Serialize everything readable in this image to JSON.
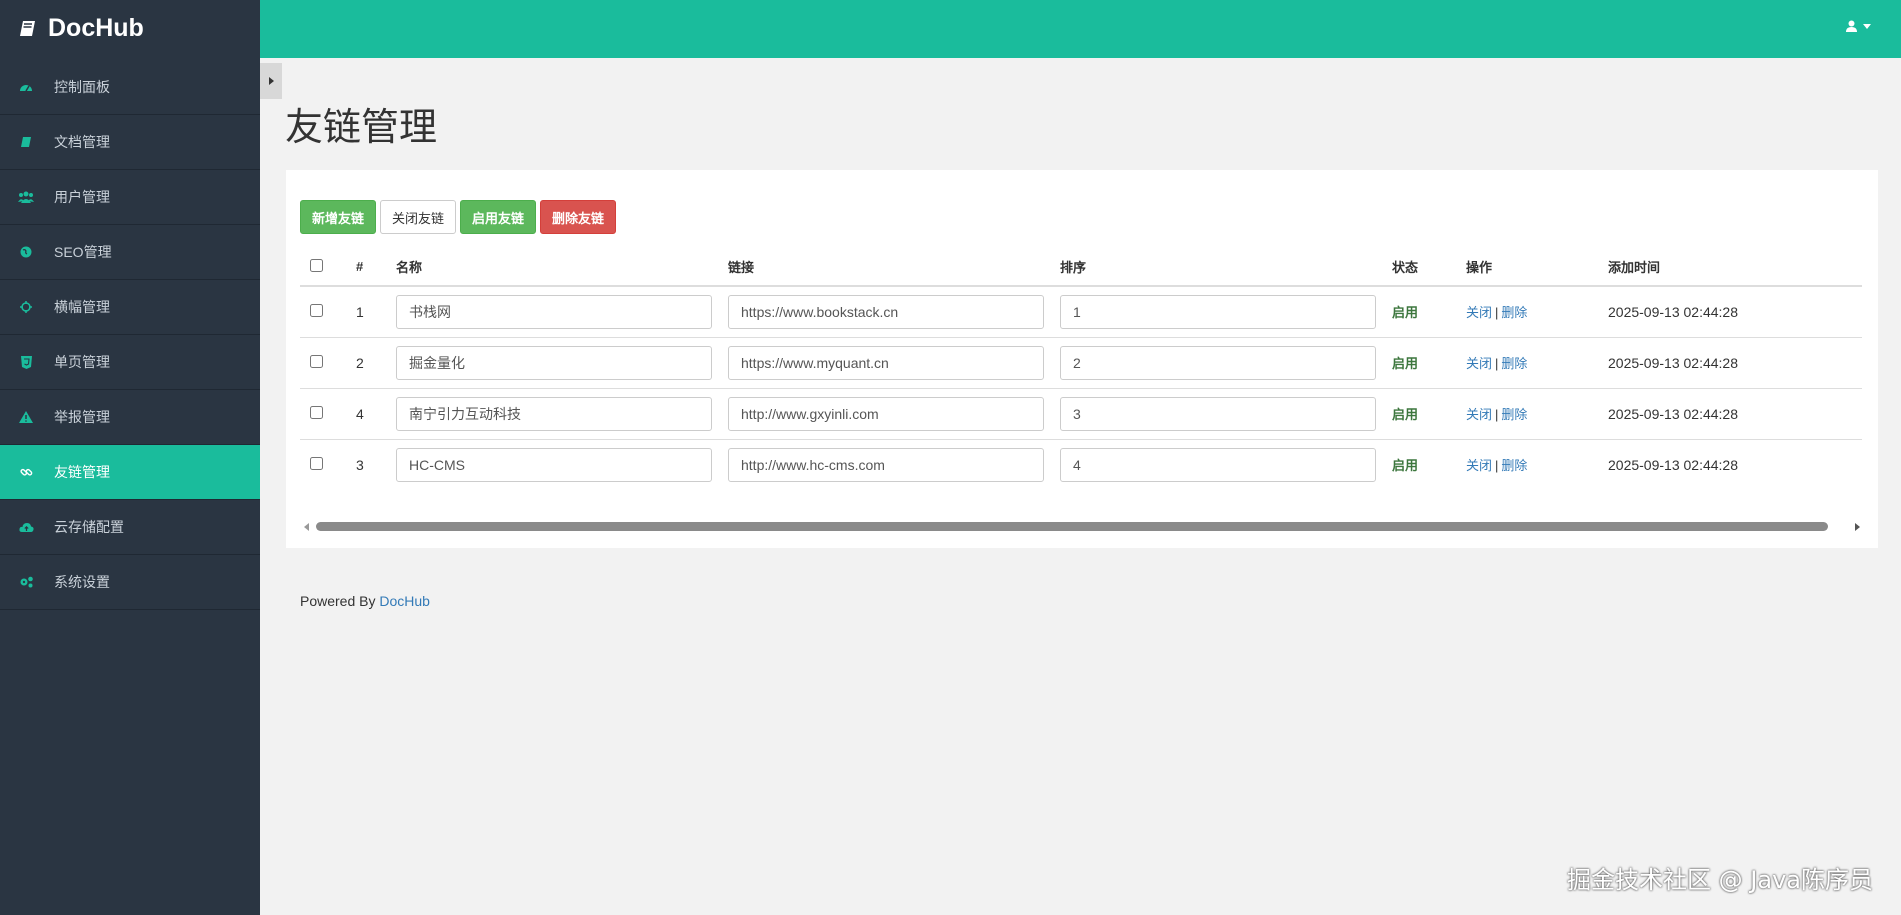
{
  "brand": {
    "name": "DocHub",
    "icon": "book-icon"
  },
  "sidebar": {
    "items": [
      {
        "label": "控制面板",
        "icon": "dashboard-icon",
        "active": false
      },
      {
        "label": "文档管理",
        "icon": "book-icon",
        "active": false
      },
      {
        "label": "用户管理",
        "icon": "users-icon",
        "active": false
      },
      {
        "label": "SEO管理",
        "icon": "globe-icon",
        "active": false
      },
      {
        "label": "横幅管理",
        "icon": "crosshairs-icon",
        "active": false
      },
      {
        "label": "单页管理",
        "icon": "html5-icon",
        "active": false
      },
      {
        "label": "举报管理",
        "icon": "warning-icon",
        "active": false
      },
      {
        "label": "友链管理",
        "icon": "link-icon",
        "active": true
      },
      {
        "label": "云存储配置",
        "icon": "cloud-upload-icon",
        "active": false
      },
      {
        "label": "系统设置",
        "icon": "gears-icon",
        "active": false
      }
    ]
  },
  "topbar": {
    "user_icon": "user-icon"
  },
  "page": {
    "title": "友链管理"
  },
  "toolbar": {
    "add_label": "新增友链",
    "close_label": "关闭友链",
    "enable_label": "启用友链",
    "delete_label": "删除友链"
  },
  "table": {
    "headers": {
      "index": "#",
      "name": "名称",
      "link": "链接",
      "sort": "排序",
      "status": "状态",
      "ops": "操作",
      "time": "添加时间"
    },
    "rows": [
      {
        "id": "1",
        "name": "书栈网",
        "link": "https://www.bookstack.cn",
        "sort": "1",
        "status": "启用",
        "op_close": "关闭",
        "op_sep": "|",
        "op_delete": "删除",
        "time": "2025-09-13 02:44:28"
      },
      {
        "id": "2",
        "name": "掘金量化",
        "link": "https://www.myquant.cn",
        "sort": "2",
        "status": "启用",
        "op_close": "关闭",
        "op_sep": "|",
        "op_delete": "删除",
        "time": "2025-09-13 02:44:28"
      },
      {
        "id": "4",
        "name": "南宁引力互动科技",
        "link": "http://www.gxyinli.com",
        "sort": "3",
        "status": "启用",
        "op_close": "关闭",
        "op_sep": "|",
        "op_delete": "删除",
        "time": "2025-09-13 02:44:28"
      },
      {
        "id": "3",
        "name": "HC-CMS",
        "link": "http://www.hc-cms.com",
        "sort": "4",
        "status": "启用",
        "op_close": "关闭",
        "op_sep": "|",
        "op_delete": "删除",
        "time": "2025-09-13 02:44:28"
      }
    ]
  },
  "footer": {
    "prefix": "Powered By ",
    "link": "DocHub"
  },
  "watermark": "掘金技术社区 @ Java陈序员",
  "colors": {
    "accent": "#1abc9c",
    "sidebar_bg": "#2a3542",
    "success": "#5cb85c",
    "danger": "#d9534f",
    "link": "#337ab7"
  }
}
